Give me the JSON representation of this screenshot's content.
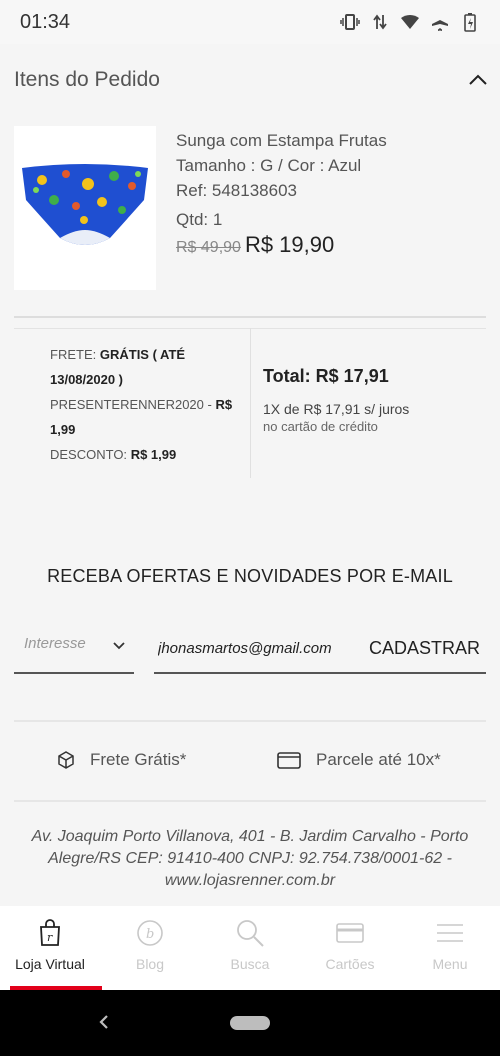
{
  "status_bar": {
    "time": "01:34",
    "icons": [
      "vibrate-icon",
      "data-arrows-icon",
      "wifi-icon",
      "airplane-icon",
      "battery-icon"
    ]
  },
  "order": {
    "section_title": "Itens do Pedido",
    "product": {
      "name": "Sunga com Estampa Frutas",
      "size_color": "Tamanho : G / Cor : Azul",
      "ref": "Ref: 548138603",
      "qty": "Qtd: 1",
      "old_price": "R$ 49,90",
      "new_price": "R$ 19,90"
    }
  },
  "summary": {
    "shipping_label": "FRETE:",
    "shipping_value": "GRÁTIS ( ATÉ 13/08/2020 )",
    "coupon_label": "PRESENTERENNER2020 -",
    "coupon_value": "R$ 1,99",
    "discount_label": "DESCONTO:",
    "discount_value": "R$ 1,99",
    "total": "Total: R$ 17,91",
    "installments": "1X de R$ 17,91 s/ juros",
    "installments_note": "no cartão de crédito"
  },
  "newsletter": {
    "title": "RECEBA OFERTAS E NOVIDADES POR E-MAIL",
    "interest_placeholder": "Interesse",
    "email_value": "jhonasmartos@gmail.com",
    "signup_label": "CADASTRAR"
  },
  "benefits": {
    "free_shipping": "Frete Grátis*",
    "installments": "Parcele até 10x*"
  },
  "footer": {
    "address": "Av. Joaquim Porto Villanova, 401 - B. Jardim Carvalho - Porto Alegre/RS CEP: 91410-400 CNPJ: 92.754.738/0001-62 - www.lojasrenner.com.br"
  },
  "bottom_nav": {
    "items": [
      {
        "label": "Loja Virtual",
        "icon": "store-bag-icon",
        "active": true
      },
      {
        "label": "Blog",
        "icon": "blog-icon",
        "active": false
      },
      {
        "label": "Busca",
        "icon": "search-icon",
        "active": false
      },
      {
        "label": "Cartões",
        "icon": "card-icon",
        "active": false
      },
      {
        "label": "Menu",
        "icon": "menu-icon",
        "active": false
      }
    ]
  },
  "colors": {
    "accent": "#e2001a",
    "product_blue": "#1f4fd1"
  }
}
